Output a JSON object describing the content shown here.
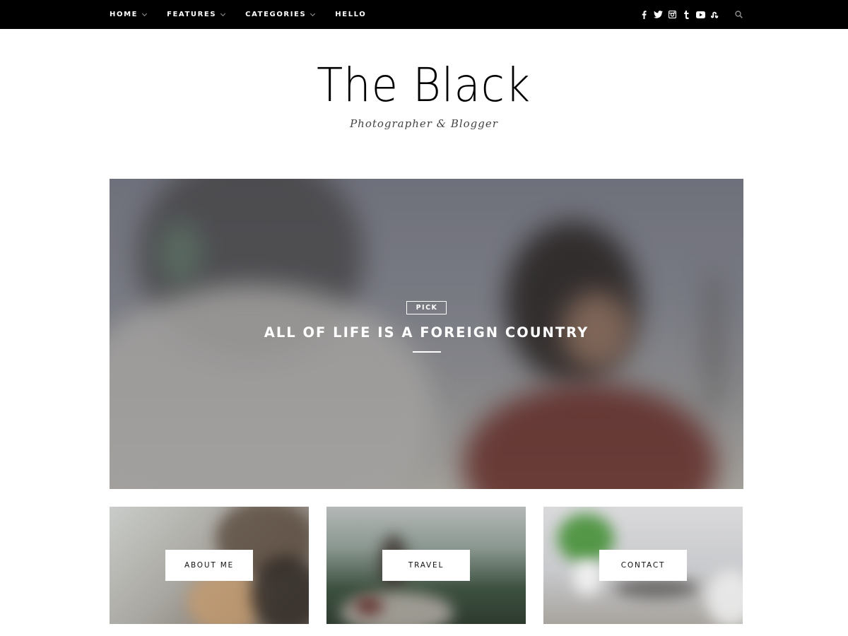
{
  "nav": {
    "items": [
      {
        "label": "HOME",
        "has_dropdown": true
      },
      {
        "label": "FEATURES",
        "has_dropdown": true
      },
      {
        "label": "CATEGORIES",
        "has_dropdown": true
      },
      {
        "label": "HELLO",
        "has_dropdown": false
      }
    ],
    "social_icons": [
      "facebook-icon",
      "twitter-icon",
      "instagram-icon",
      "tumblr-icon",
      "youtube-icon",
      "stumbleupon-icon"
    ],
    "search_icon": "search-icon"
  },
  "logo": {
    "title": "The Black",
    "tagline": "Photographer & Blogger"
  },
  "hero": {
    "badge": "PICK",
    "title": "ALL OF LIFE IS A FOREIGN COUNTRY"
  },
  "cards": [
    {
      "label": "ABOUT ME"
    },
    {
      "label": "TRAVEL"
    },
    {
      "label": "CONTACT"
    }
  ],
  "colors": {
    "topbar_bg": "#000000",
    "page_bg": "#ffffff",
    "text": "#111111"
  }
}
